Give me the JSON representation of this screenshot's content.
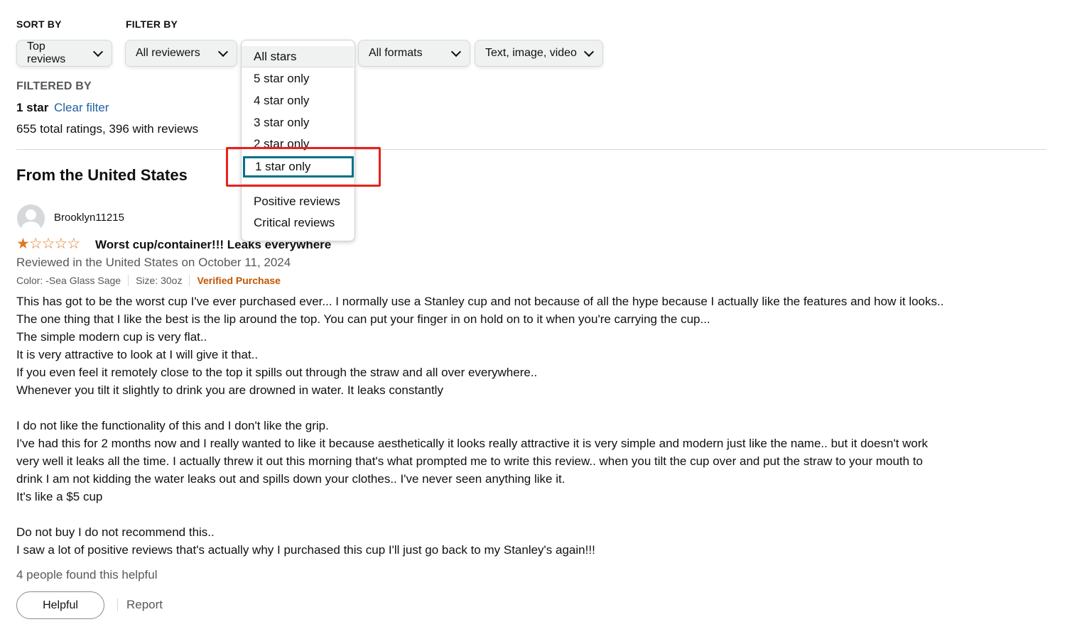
{
  "sort": {
    "label": "SORT BY",
    "selected": "Top reviews"
  },
  "filter": {
    "label": "FILTER BY",
    "reviewers": "All reviewers",
    "formats": "All formats",
    "media": "Text, image, video"
  },
  "stars_dropdown": {
    "options": [
      "All stars",
      "5 star only",
      "4 star only",
      "3 star only",
      "2 star only",
      "1 star only"
    ],
    "extra_options": [
      "Positive reviews",
      "Critical reviews"
    ],
    "selected": "1 star only"
  },
  "filtered": {
    "label": "FILTERED BY",
    "value": "1 star",
    "clear": "Clear filter",
    "totals": "655 total ratings, 396 with reviews"
  },
  "section": {
    "title": "From the United States"
  },
  "review": {
    "author": "Brooklyn11215",
    "rating": 1,
    "max_rating": 5,
    "title": "Worst cup/container!!! Leaks everywhere",
    "date_line": "Reviewed in the United States on October 11, 2024",
    "color": "Color: -Sea Glass Sage",
    "size": "Size: 30oz",
    "verified": "Verified Purchase",
    "body": [
      "This has got to be the worst cup I've ever purchased ever... I normally use a Stanley cup and not because of all the hype because I actually like the features and how it looks..",
      "The one thing that I like the best is the lip around the top. You can put your finger in on hold on to it when you're carrying the cup...",
      "The simple modern cup is very flat..",
      "It is very attractive to look at I will give it that..",
      "If you even feel it remotely close to the top it spills out through the straw and all over everywhere..",
      "Whenever you tilt it slightly to drink you are drowned in water. It leaks constantly",
      "",
      "I do not like the functionality of this and I don't like the grip.",
      "I've had this for 2 months now and I really wanted to like it because aesthetically it looks really attractive it is very simple and modern just like the name.. but it doesn't work",
      "very well it leaks all the time. I actually threw it out this morning that's what prompted me to write this review.. when you tilt the cup over and put the straw to your mouth to",
      "drink I am not kidding the water leaks out and spills down your clothes.. I've never seen anything like it.",
      "It's like a $5 cup",
      "",
      "Do not buy I do not recommend this..",
      "I saw a lot of positive reviews that's actually why I purchased this cup I'll just go back to my Stanley's again!!!"
    ],
    "helpful_count": "4 people found this helpful",
    "helpful_button": "Helpful",
    "report": "Report"
  },
  "colors": {
    "link": "#2162a1",
    "star": "#de7921",
    "verified": "#c45500",
    "highlight": "#e8221b",
    "focus": "#007185"
  }
}
